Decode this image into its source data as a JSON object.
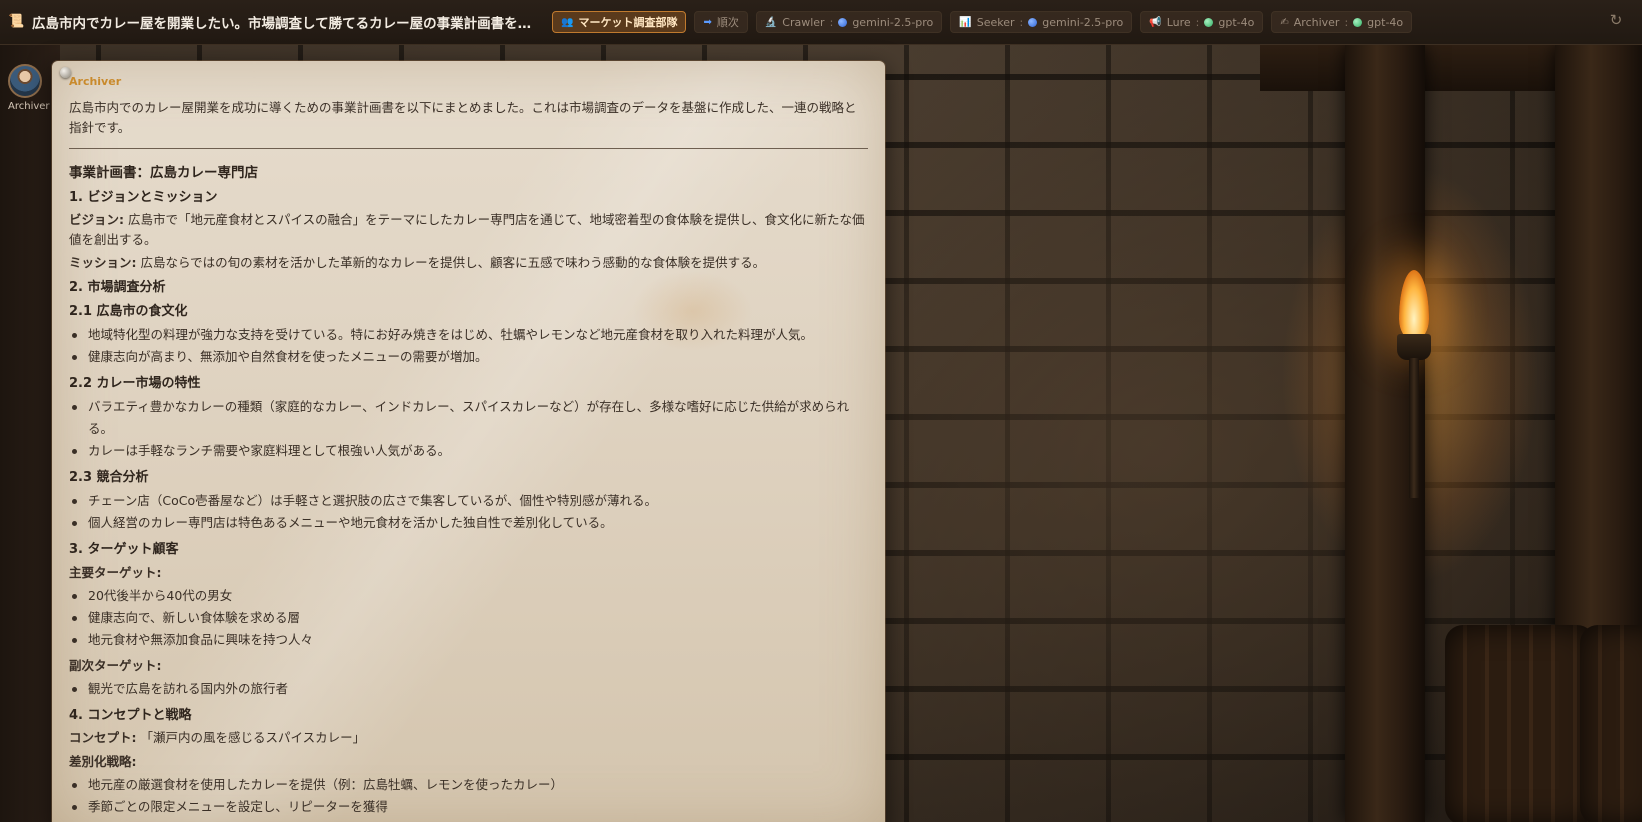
{
  "header": {
    "title": "広島市内でカレー屋を開業したい。市場調査して勝てるカレー屋の事業計画書を作成して...",
    "team_chip": "マーケット調査部隊",
    "order_chip": "順次",
    "agents": [
      {
        "name": "Crawler",
        "model": "gemini-2.5-pro",
        "icon": "microscope-icon",
        "dot": "blue"
      },
      {
        "name": "Seeker",
        "model": "gemini-2.5-pro",
        "icon": "chart-icon",
        "dot": "blue"
      },
      {
        "name": "Lure",
        "model": "gpt-4o",
        "icon": "megaphone-icon",
        "dot": "green"
      },
      {
        "name": "Archiver",
        "model": "gpt-4o",
        "icon": "writing-hand-icon",
        "dot": "green"
      }
    ],
    "separator": ":"
  },
  "avatar": {
    "label": "Archiver"
  },
  "message": {
    "sender": "Archiver",
    "intro": "広島市内でのカレー屋開業を成功に導くための事業計画書を以下にまとめました。これは市場調査のデータを基盤に作成した、一連の戦略と指針です。",
    "doc_title": "事業計画書：広島カレー専門店",
    "s1_title": "1. ビジョンとミッション",
    "vision_label": "ビジョン:",
    "vision_text": " 広島市で「地元産食材とスパイスの融合」をテーマにしたカレー専門店を通じて、地域密着型の食体験を提供し、食文化に新たな価値を創出する。",
    "mission_label": "ミッション:",
    "mission_text": " 広島ならではの旬の素材を活かした革新的なカレーを提供し、顧客に五感で味わう感動的な食体験を提供する。",
    "s2_title": "2. 市場調査分析",
    "s21_title": "2.1 広島市の食文化",
    "s21_items": [
      "地域特化型の料理が強力な支持を受けている。特にお好み焼きをはじめ、牡蠣やレモンなど地元産食材を取り入れた料理が人気。",
      "健康志向が高まり、無添加や自然食材を使ったメニューの需要が増加。"
    ],
    "s22_title": "2.2 カレー市場の特性",
    "s22_items": [
      "バラエティ豊かなカレーの種類（家庭的なカレー、インドカレー、スパイスカレーなど）が存在し、多様な嗜好に応じた供給が求められる。",
      "カレーは手軽なランチ需要や家庭料理として根強い人気がある。"
    ],
    "s23_title": "2.3 競合分析",
    "s23_items": [
      "チェーン店（CoCo壱番屋など）は手軽さと選択肢の広さで集客しているが、個性や特別感が薄れる。",
      "個人経営のカレー専門店は特色あるメニューや地元食材を活かした独自性で差別化している。"
    ],
    "s3_title": "3. ターゲット顧客",
    "primary_label": "主要ターゲット:",
    "primary_items": [
      "20代後半から40代の男女",
      "健康志向で、新しい食体験を求める層",
      "地元食材や無添加食品に興味を持つ人々"
    ],
    "secondary_label": "副次ターゲット:",
    "secondary_items": [
      "観光で広島を訪れる国内外の旅行者"
    ],
    "s4_title": "4. コンセプトと戦略",
    "concept_label": "コンセプト:",
    "concept_text": " 「瀬戸内の風を感じるスパイスカレー」",
    "diff_label": "差別化戦略:",
    "diff_items": [
      "地元産の厳選食材を使用したカレーを提供（例：広島牡蠣、レモンを使ったカレー）",
      "季節ごとの限定メニューを設定し、リピーターを獲得"
    ]
  }
}
